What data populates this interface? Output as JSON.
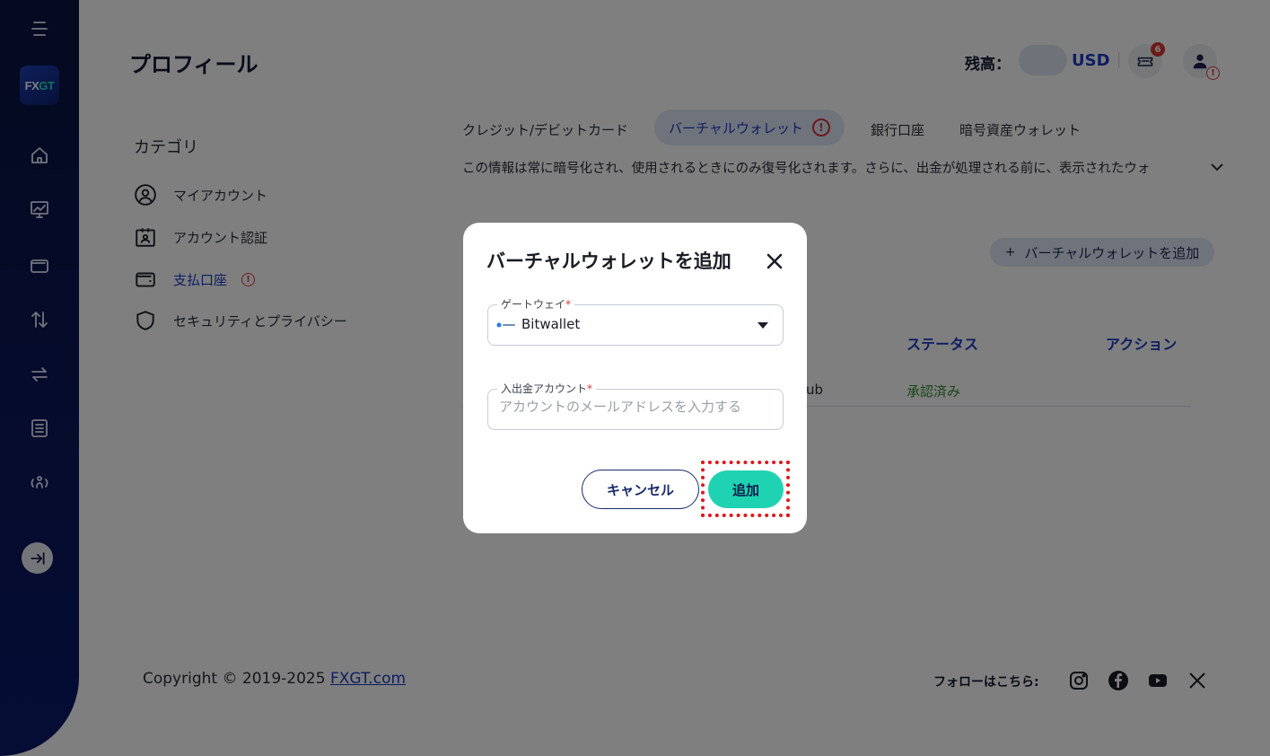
{
  "header": {
    "title": "プロフィール",
    "balance_label": "残高：",
    "currency": "USD",
    "notification_count": "6"
  },
  "sidebar": {
    "logo_fx": "FX",
    "logo_gt": "GT",
    "icons": [
      "menu-icon",
      "home-icon",
      "chart-icon",
      "wallet-icon",
      "transfer-icon",
      "swap-icon",
      "list-icon",
      "partner-icon",
      "collapse-icon"
    ]
  },
  "category": {
    "title": "カテゴリ",
    "items": [
      {
        "label": "マイアカウント"
      },
      {
        "label": "アカウント認証"
      },
      {
        "label": "支払口座"
      },
      {
        "label": "セキュリティとプライバシー"
      }
    ]
  },
  "tabs": [
    {
      "label": "クレジット/デビットカード"
    },
    {
      "label": "バーチャルウォレット"
    },
    {
      "label": "銀行口座"
    },
    {
      "label": "暗号資産ウォレット"
    }
  ],
  "info_text": "この情報は常に暗号化され、使用されるときにのみ復号化されます。さらに、出金が処理される前に、表示されたウォ",
  "add_wallet_label": "バーチャルウォレットを追加",
  "table": {
    "headers": {
      "status": "ステータス",
      "action": "アクション"
    },
    "row": {
      "name_fragment": "ub",
      "status": "承認済み"
    }
  },
  "footer": {
    "copyright": "Copyright © 2019-2025 ",
    "link": "FXGT.com",
    "follow": "フォローはこちら:"
  },
  "modal": {
    "title": "バーチャルウォレットを追加",
    "gateway": {
      "label": "ゲートウェイ",
      "required": "*",
      "value": "Bitwallet"
    },
    "account": {
      "label": "入出金アカウント",
      "required": "*",
      "placeholder": "アカウントのメールアドレスを入力する",
      "value": ""
    },
    "cancel_label": "キャンセル",
    "submit_label": "追加"
  },
  "colors": {
    "accent": "#1b3cc4",
    "primary_button": "#1fd3b2",
    "sidebar": "#0a1a6b",
    "warning": "#d93636",
    "highlight": "#e0161b"
  }
}
